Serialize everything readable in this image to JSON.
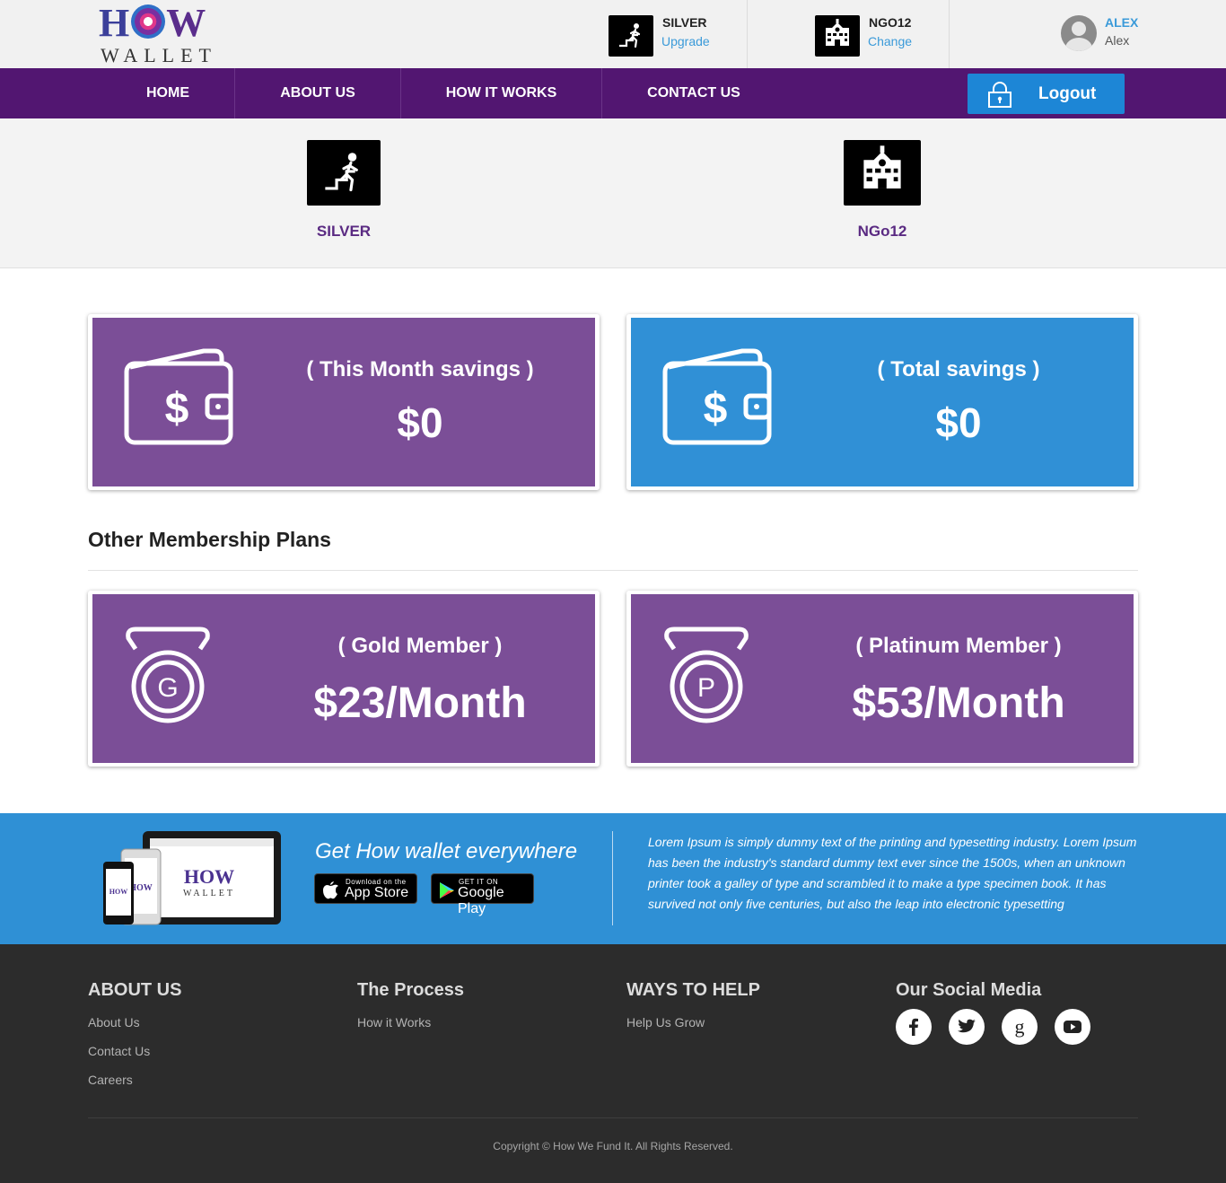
{
  "brand": {
    "logo_top": "HOW",
    "logo_bottom": "WALLET"
  },
  "header": {
    "plan": {
      "title": "SILVER",
      "link": "Upgrade",
      "icon": "stairs-runner-icon"
    },
    "ngo": {
      "title": "NGO12",
      "link": "Change",
      "icon": "school-building-icon"
    },
    "user": {
      "name": "ALEX",
      "sub": "Alex"
    }
  },
  "nav": {
    "items": [
      "HOME",
      "ABOUT US",
      "HOW IT WORKS",
      "CONTACT US"
    ],
    "logout": "Logout"
  },
  "band": {
    "plan_label": "SILVER",
    "ngo_label": "NGo12"
  },
  "savings": [
    {
      "title": "( This Month savings )",
      "value": "$0",
      "color": "#7b4e97"
    },
    {
      "title": "( Total savings )",
      "value": "$0",
      "color": "#3090d6"
    }
  ],
  "plans_section": {
    "title": "Other Membership Plans"
  },
  "plans": [
    {
      "title": "( Gold Member )",
      "value": "$23/Month",
      "badge": "G"
    },
    {
      "title": "( Platinum Member )",
      "value": "$53/Month",
      "badge": "P"
    }
  ],
  "app_band": {
    "heading": "Get How wallet everywhere",
    "appstore_small": "Download on the",
    "appstore_big": "App Store",
    "play_small": "GET IT ON",
    "play_big": "Google Play",
    "text": "Lorem Ipsum is simply dummy text of the printing and typesetting industry. Lorem Ipsum has been the industry's standard dummy text ever since the 1500s, when an unknown printer took a galley of type and scrambled it to make a type specimen book. It has survived not only five centuries, but also the leap into electronic typesetting"
  },
  "footer": {
    "about": {
      "head": "ABOUT US",
      "links": [
        "About Us",
        "Contact Us",
        "Careers"
      ]
    },
    "process": {
      "head": "The Process",
      "links": [
        "How it Works"
      ]
    },
    "help": {
      "head": "WAYS TO HELP",
      "links": [
        "Help Us Grow"
      ]
    },
    "social": {
      "head": "Our Social Media",
      "icons": [
        "facebook-icon",
        "twitter-icon",
        "google-plus-icon",
        "youtube-icon"
      ]
    },
    "copyright": "Copyright © How We Fund It. All Rights Reserved."
  },
  "colors": {
    "nav": "#521671",
    "accent_blue": "#3090d6",
    "card_purple": "#7b4e97",
    "footer": "#2c2c2c"
  }
}
